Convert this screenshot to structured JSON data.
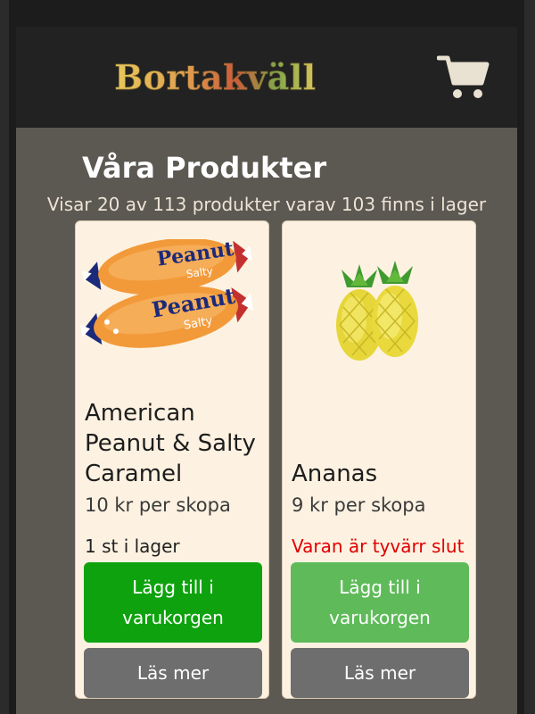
{
  "header": {
    "logo": "Bortakväll"
  },
  "page": {
    "title": "Våra Produkter",
    "subtitle": "Visar 20 av 113 produkter varav 103 finns i lager"
  },
  "products": [
    {
      "name": "American Peanut & Salty Caramel",
      "price": "10 kr per skopa",
      "stock": "1 st i lager",
      "add_label": "Lägg till i varukorgen",
      "more_label": "Läs mer"
    },
    {
      "name": "Ananas",
      "price": "9 kr per skopa",
      "stock": "Varan är tyvärr slut",
      "add_label": "Lägg till i varukorgen",
      "more_label": "Läs mer"
    }
  ],
  "icons": {
    "cart": "shopping-cart-icon"
  },
  "colors": {
    "header_bg": "#222222",
    "content_bg": "#5c5852",
    "card_bg": "#fdf2e1",
    "add_button": "#0ea30e",
    "add_button_disabled": "#5fbb5a",
    "more_button": "#6e6e6e",
    "out_of_stock_text": "#e00000"
  }
}
